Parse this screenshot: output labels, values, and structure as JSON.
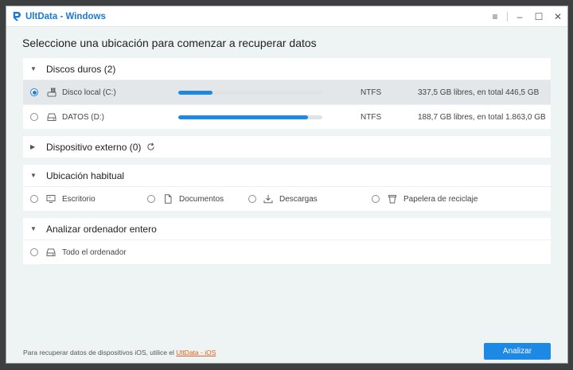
{
  "window": {
    "title": "UltData - Windows"
  },
  "window_controls": {
    "menu": "≡",
    "minimize": "–",
    "maximize": "☐",
    "close": "✕"
  },
  "heading": "Seleccione una ubicación para comenzar a recuperar datos",
  "hard_drives": {
    "label": "Discos duros (2)",
    "drives": [
      {
        "name": "Disco local (C:)",
        "fs": "NTFS",
        "info": "337,5 GB libres, en total 446,5 GB",
        "used_fraction": 0.24,
        "selected": true
      },
      {
        "name": "DATOS (D:)",
        "fs": "NTFS",
        "info": "188,7 GB libres, en total 1.863,0 GB",
        "used_fraction": 0.9,
        "selected": false
      }
    ]
  },
  "external": {
    "label": "Dispositivo externo (0)"
  },
  "common": {
    "label": "Ubicación habitual",
    "items": [
      "Escritorio",
      "Documentos",
      "Descargas",
      "Papelera de reciclaje"
    ]
  },
  "whole": {
    "label": "Analizar ordenador entero",
    "item": "Todo el ordenador"
  },
  "footer": {
    "note": "Para recuperar datos de dispositivos iOS, utilice el ",
    "link": "UltData - iOS"
  },
  "analyze_button": "Analizar",
  "colors": {
    "accent": "#1e88e5",
    "link": "#e8601c"
  }
}
